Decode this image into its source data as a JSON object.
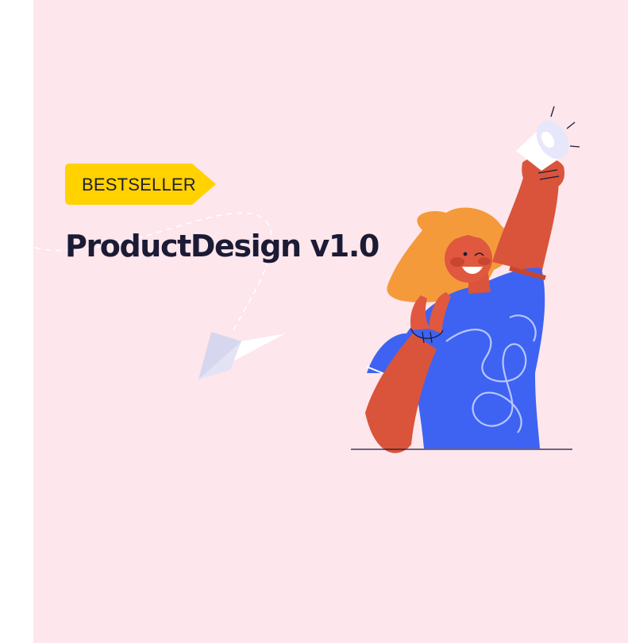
{
  "hero": {
    "badge_label": "BESTSELLER",
    "title": "ProductDesign v1.0"
  },
  "colors": {
    "background": "#fde6ec",
    "badge": "#ffd200",
    "title": "#1b1b35",
    "shirt": "#3e63f2",
    "skin": "#e0583f",
    "hair": "#f59a3b"
  },
  "icons": {
    "paper_plane": "paper-plane-icon",
    "megaphone": "megaphone-icon"
  }
}
